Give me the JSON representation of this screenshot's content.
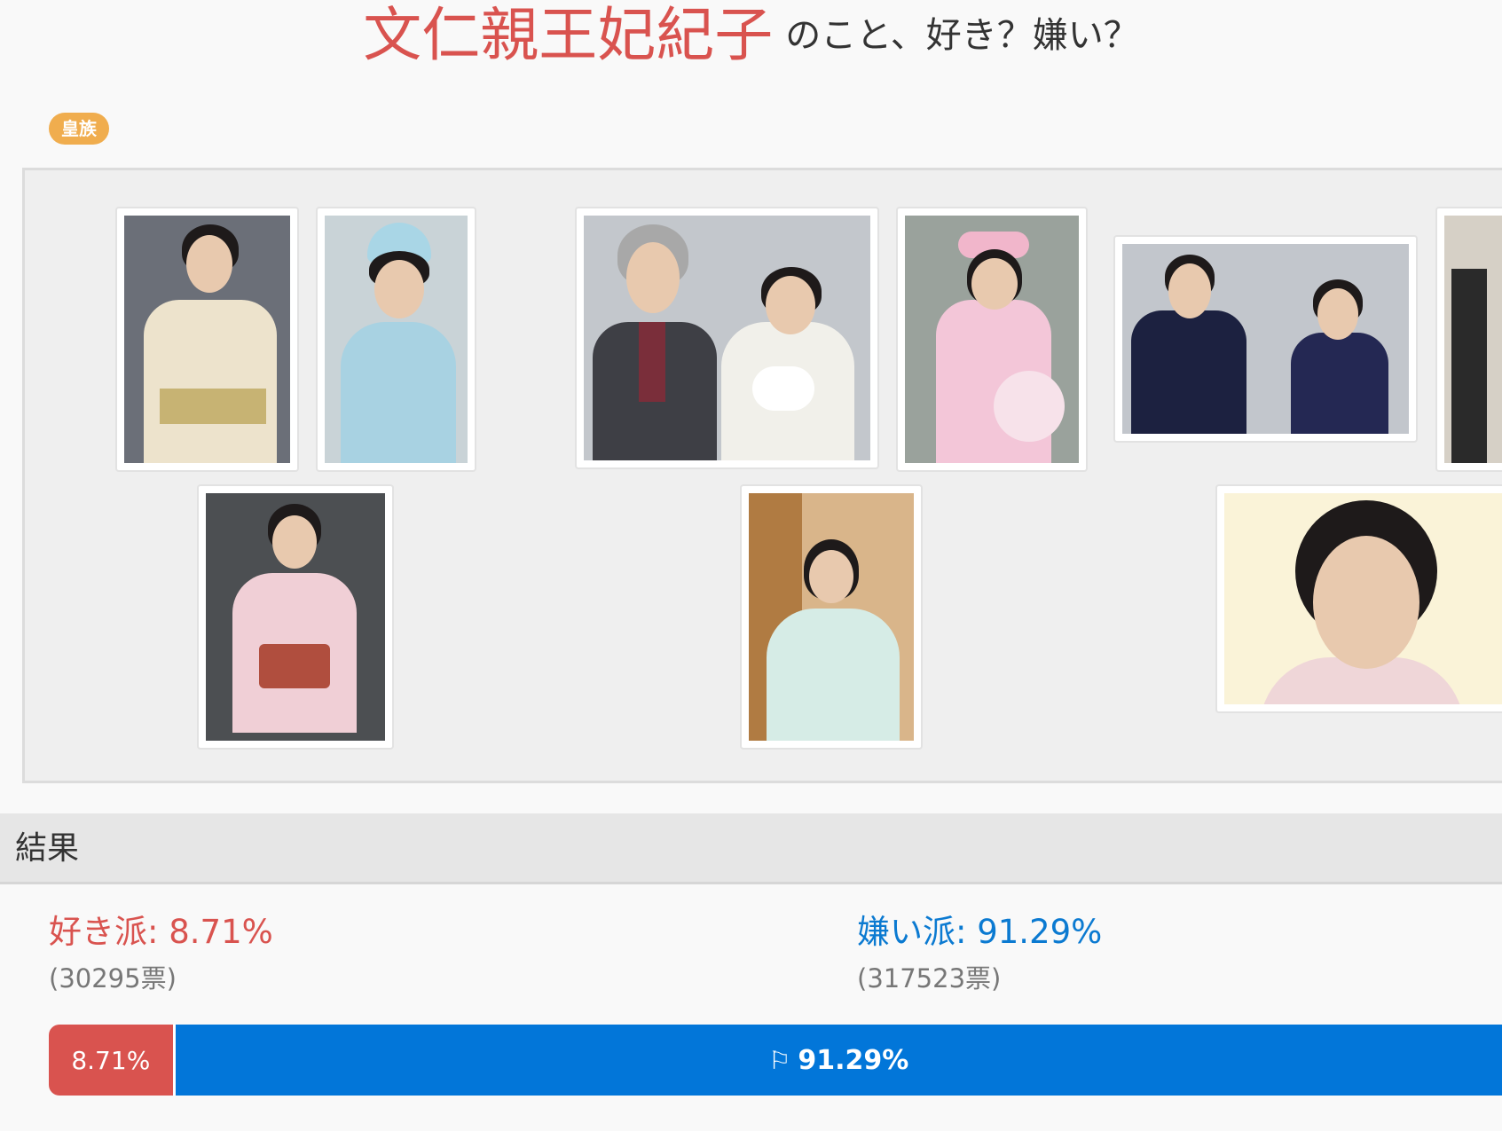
{
  "header": {
    "name": "文仁親王妃紀子",
    "question": "のこと、好き？嫌い？"
  },
  "category_tag": "皇族",
  "results": {
    "section_title": "結果",
    "like_label": "好き派: 8.71%",
    "like_votes": "(30295票)",
    "dislike_label": "嫌い派: 91.29%",
    "dislike_votes": "(317523票)",
    "like_percent": 8.71,
    "dislike_percent": 91.29,
    "like_bar_text": "8.71%",
    "dislike_bar_text": "91.29%",
    "like_color": "#d9534f",
    "dislike_color": "#0276d9"
  },
  "icons": {
    "bar_flag": "checkered-flag-icon",
    "bar_flag_glyph": "⚐"
  }
}
